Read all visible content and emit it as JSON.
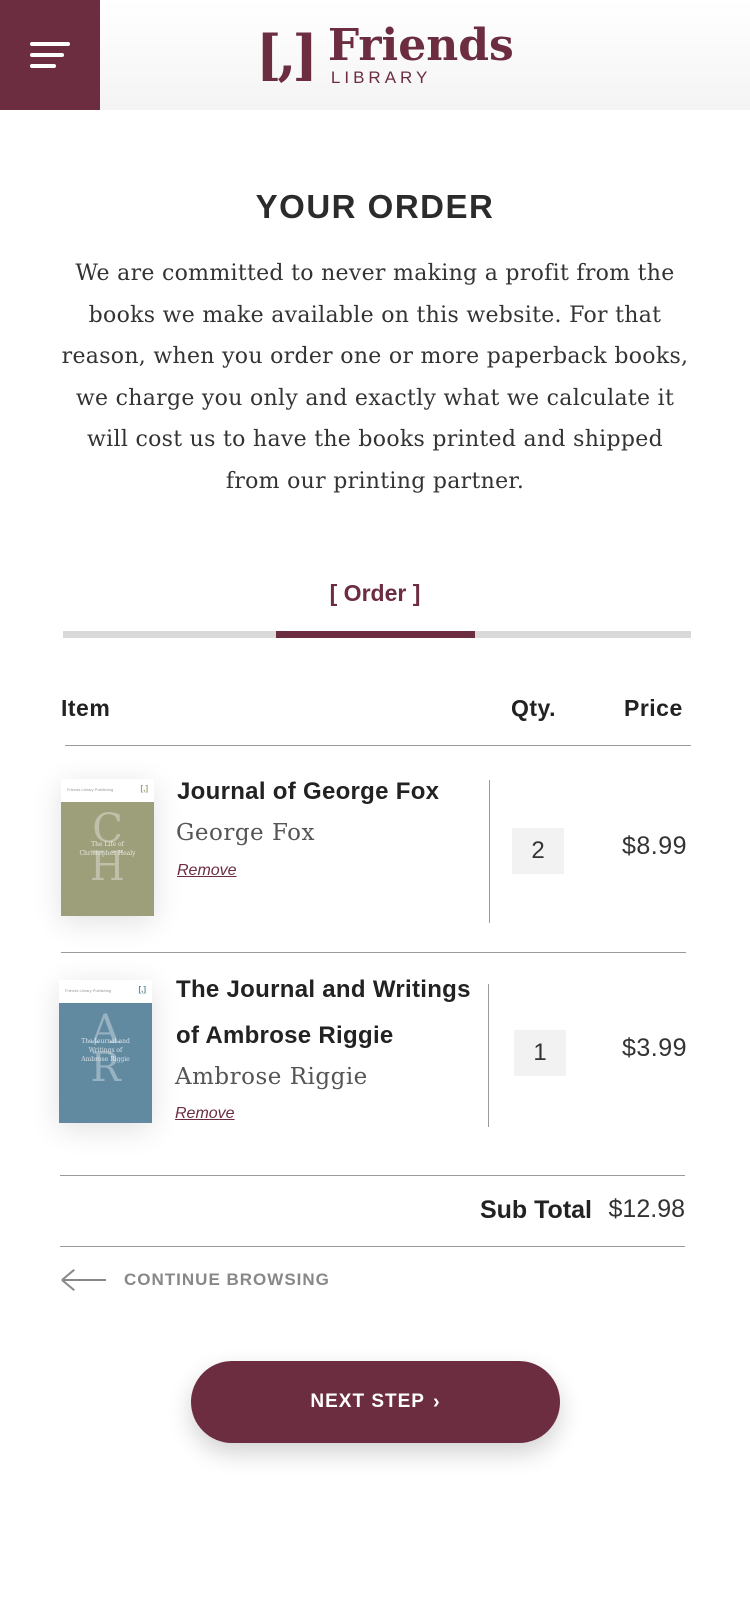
{
  "header": {
    "menu_icon": "hamburger-menu-icon",
    "logo_bracket": "[,]",
    "logo_word": "Friends",
    "logo_sub": "LIBRARY",
    "brand_color": "#6c2d40"
  },
  "page": {
    "title": "YOUR ORDER",
    "intro": "We are committed to never making a profit from the books we make available on this website. For that reason, when you order one or more paperback books, we charge you only and exactly what we calculate it will cost us to have the books printed and shipped from our printing partner."
  },
  "steps": {
    "current_label": "[ Order ]",
    "current_step": 2,
    "total_steps": 3
  },
  "table": {
    "headers": {
      "item": "Item",
      "qty": "Qty.",
      "price": "Price"
    },
    "items": [
      {
        "title": "Journal of George Fox",
        "author": "George Fox",
        "remove_label": "Remove",
        "qty": "2",
        "price": "$8.99",
        "cover": {
          "color": "#9d9f7b",
          "letters": [
            "C",
            "H"
          ],
          "text": [
            "The Life of",
            "Christopher Healy"
          ],
          "author_small": "Christopher Healy"
        }
      },
      {
        "title_line1": "The Journal and Writings",
        "title_line2": "of Ambrose Riggie",
        "author": "Ambrose Riggie",
        "remove_label": "Remove",
        "qty": "1",
        "price": "$3.99",
        "cover": {
          "color": "#6189a0",
          "letters": [
            "A",
            "R"
          ],
          "text": [
            "The Journal and",
            "Writings of",
            "Ambrose Riggie"
          ],
          "author_small": "Ambrose Riggie"
        }
      }
    ],
    "subtotal_label": "Sub Total",
    "subtotal_value": "$12.98"
  },
  "nav": {
    "continue_label": "CONTINUE BROWSING",
    "continue_icon": "arrow-left-icon",
    "next_label": "NEXT STEP",
    "next_icon": "chevron-right-icon"
  }
}
